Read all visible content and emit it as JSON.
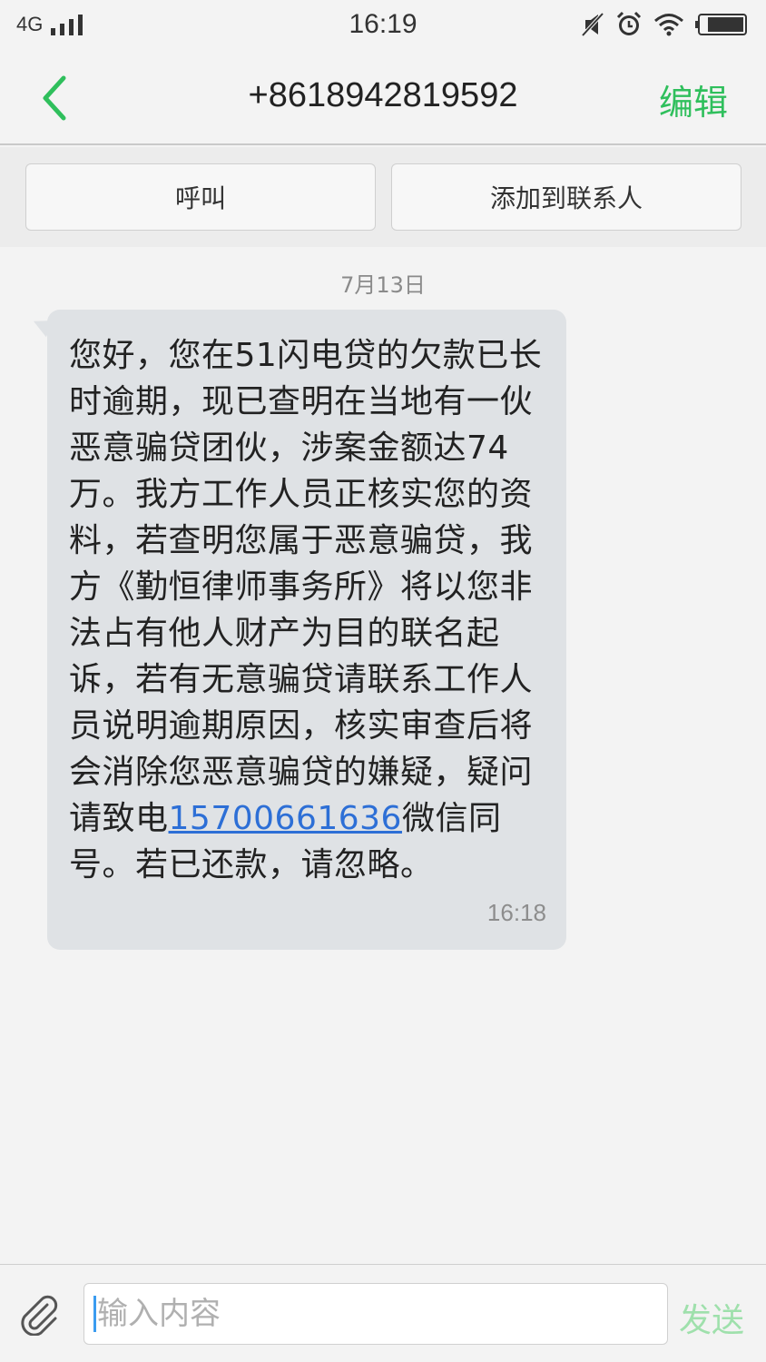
{
  "status_bar": {
    "network": "4G",
    "time": "16:19"
  },
  "header": {
    "title": "+8618942819592",
    "edit_label": "编辑"
  },
  "actions": {
    "call_label": "呼叫",
    "add_contact_label": "添加到联系人"
  },
  "conversation": {
    "date": "7月13日",
    "message": {
      "text_before_link": "您好，您在51闪电贷的欠款已长时逾期，现已查明在当地有一伙恶意骗贷团伙，涉案金额达74万。我方工作人员正核实您的资料，若查明您属于恶意骗贷，我方《勤恒律师事务所》将以您非法占有他人财产为目的联名起诉，若有无意骗贷请联系工作人员说明逾期原因，核实审查后将会消除您恶意骗贷的嫌疑，疑问请致电",
      "link": "15700661636",
      "text_after_link": "微信同号。若已还款，请忽略。",
      "time": "16:18"
    }
  },
  "composer": {
    "placeholder": "输入内容",
    "send_label": "发送"
  },
  "colors": {
    "accent": "#2fbf5c",
    "send_disabled": "#9fe0ac",
    "bubble": "#dfe2e5",
    "link": "#2d6fd6"
  },
  "icons": [
    "back-chevron-icon",
    "signal-icon",
    "silent-icon",
    "alarm-icon",
    "wifi-icon",
    "battery-icon",
    "attachment-icon"
  ]
}
